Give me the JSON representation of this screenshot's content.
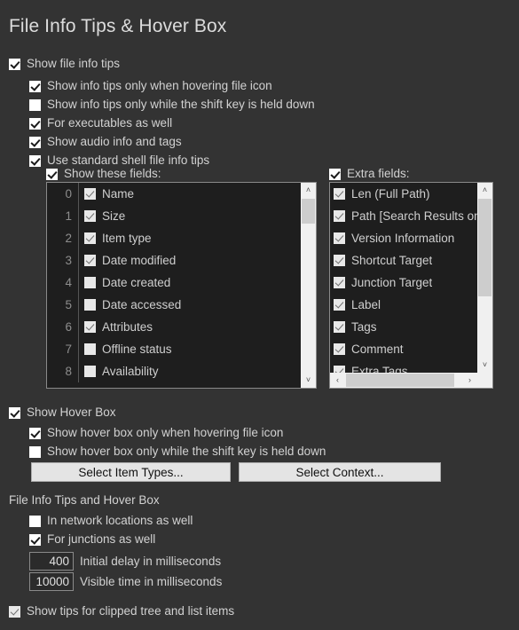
{
  "page": {
    "title": "File Info Tips & Hover Box",
    "background_color": "#333333",
    "text_color": "#d2d2d2"
  },
  "info_tips": {
    "show_file_info_tips": {
      "label": "Show file info tips",
      "checked": true
    },
    "children": [
      {
        "label": "Show info tips only when hovering file icon",
        "checked": true
      },
      {
        "label": "Show info tips only while the shift key is held down",
        "checked": false
      },
      {
        "label": "For executables as well",
        "checked": true
      },
      {
        "label": "Show audio info and tags",
        "checked": true
      },
      {
        "label": "Use standard shell file info tips",
        "checked": true
      }
    ]
  },
  "shell_fields": {
    "show_these_fields": {
      "label": "Show these fields:",
      "checked": true
    },
    "extra_fields": {
      "label": "Extra fields:",
      "checked": true
    },
    "fields_list": [
      {
        "index": "0",
        "label": "Name",
        "checked": true
      },
      {
        "index": "1",
        "label": "Size",
        "checked": true
      },
      {
        "index": "2",
        "label": "Item type",
        "checked": true
      },
      {
        "index": "3",
        "label": "Date modified",
        "checked": true
      },
      {
        "index": "4",
        "label": "Date created",
        "checked": false
      },
      {
        "index": "5",
        "label": "Date accessed",
        "checked": false
      },
      {
        "index": "6",
        "label": "Attributes",
        "checked": true
      },
      {
        "index": "7",
        "label": "Offline status",
        "checked": false
      },
      {
        "index": "8",
        "label": "Availability",
        "checked": false
      }
    ],
    "extra_list": [
      {
        "label": "Len (Full Path)",
        "checked": true
      },
      {
        "label": "Path [Search Results only]",
        "checked": true
      },
      {
        "label": "Version Information",
        "checked": true
      },
      {
        "label": "Shortcut Target",
        "checked": true
      },
      {
        "label": "Junction Target",
        "checked": true
      },
      {
        "label": "Label",
        "checked": true
      },
      {
        "label": "Tags",
        "checked": true
      },
      {
        "label": "Comment",
        "checked": true
      },
      {
        "label": "Extra Tags",
        "checked": true
      }
    ]
  },
  "hover_box": {
    "show_hover_box": {
      "label": "Show Hover Box",
      "checked": true
    },
    "children": [
      {
        "label": "Show hover box only when hovering file icon",
        "checked": true
      },
      {
        "label": "Show hover box only while the shift key is held down",
        "checked": false
      }
    ],
    "buttons": [
      {
        "label": "Select Item Types..."
      },
      {
        "label": "Select Context..."
      }
    ]
  },
  "common": {
    "group_label": "File Info Tips and Hover Box",
    "children": [
      {
        "label": "In network locations as well",
        "checked": false
      },
      {
        "label": "For junctions as well",
        "checked": true
      }
    ],
    "initial_delay": {
      "value": "400",
      "label": "Initial delay in milliseconds"
    },
    "visible_time": {
      "value": "10000",
      "label": "Visible time in milliseconds"
    }
  },
  "footer": {
    "clipped_items": {
      "label": "Show tips for clipped tree and list items",
      "checked": true
    }
  },
  "icons": {
    "scroll_up": "˄",
    "scroll_down": "˅",
    "scroll_left": "‹",
    "scroll_right": "›"
  }
}
